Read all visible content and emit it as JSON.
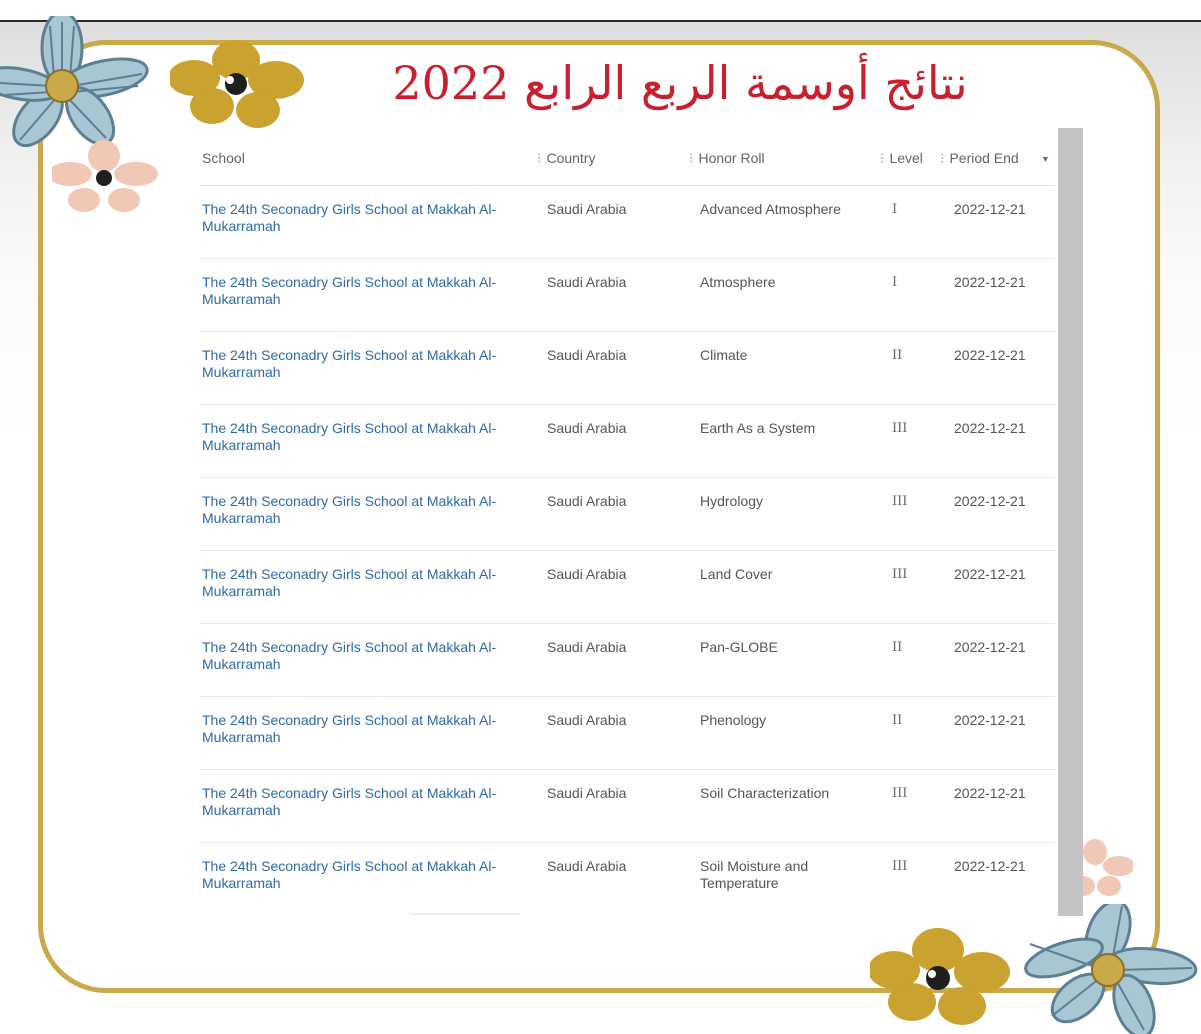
{
  "title": "نتائج أوسمة الربع الرابع 2022",
  "colors": {
    "frame": "#c9a94a",
    "title": "#c8202f",
    "link": "#2d6aa8",
    "scrollbar": "#c4c4c4"
  },
  "table": {
    "columns": {
      "school": "School",
      "country": "Country",
      "honor_roll": "Honor Roll",
      "level": "Level",
      "period_end": "Period End"
    },
    "sort_column": "period_end",
    "rows": [
      {
        "school": "The 24th Seconadry Girls School at Makkah Al-Mukarramah",
        "country": "Saudi Arabia",
        "honor_roll": "Advanced Atmosphere",
        "level": "I",
        "period_end": "2022-12-21"
      },
      {
        "school": "The 24th Seconadry Girls School at Makkah Al-Mukarramah",
        "country": "Saudi Arabia",
        "honor_roll": "Atmosphere",
        "level": "I",
        "period_end": "2022-12-21"
      },
      {
        "school": "The 24th Seconadry Girls School at Makkah Al-Mukarramah",
        "country": "Saudi Arabia",
        "honor_roll": "Climate",
        "level": "II",
        "period_end": "2022-12-21"
      },
      {
        "school": "The 24th Seconadry Girls School at Makkah Al-Mukarramah",
        "country": "Saudi Arabia",
        "honor_roll": "Earth As a System",
        "level": "III",
        "period_end": "2022-12-21"
      },
      {
        "school": "The 24th Seconadry Girls School at Makkah Al-Mukarramah",
        "country": "Saudi Arabia",
        "honor_roll": "Hydrology",
        "level": "III",
        "period_end": "2022-12-21"
      },
      {
        "school": "The 24th Seconadry Girls School at Makkah Al-Mukarramah",
        "country": "Saudi Arabia",
        "honor_roll": "Land Cover",
        "level": "III",
        "period_end": "2022-12-21"
      },
      {
        "school": "The 24th Seconadry Girls School at Makkah Al-Mukarramah",
        "country": "Saudi Arabia",
        "honor_roll": "Pan-GLOBE",
        "level": "II",
        "period_end": "2022-12-21"
      },
      {
        "school": "The 24th Seconadry Girls School at Makkah Al-Mukarramah",
        "country": "Saudi Arabia",
        "honor_roll": "Phenology",
        "level": "II",
        "period_end": "2022-12-21"
      },
      {
        "school": "The 24th Seconadry Girls School at Makkah Al-Mukarramah",
        "country": "Saudi Arabia",
        "honor_roll": "Soil Characterization",
        "level": "III",
        "period_end": "2022-12-21"
      },
      {
        "school": "The 24th Seconadry Girls School at Makkah Al-Mukarramah",
        "country": "Saudi Arabia",
        "honor_roll": "Soil Moisture and Temperature",
        "level": "III",
        "period_end": "2022-12-21"
      }
    ]
  }
}
